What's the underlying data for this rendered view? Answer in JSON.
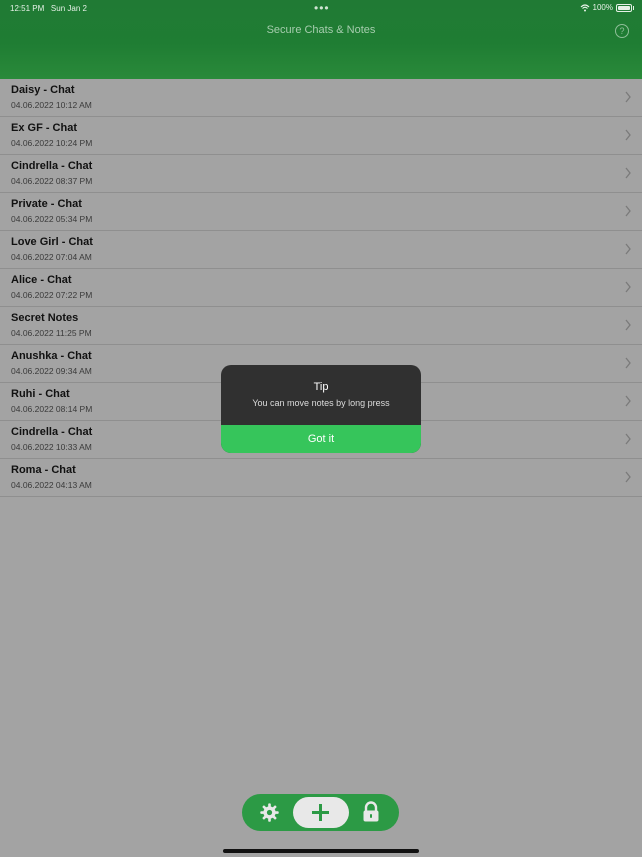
{
  "status_bar": {
    "time": "12:51 PM",
    "date": "Sun Jan 2",
    "battery": "100%"
  },
  "header": {
    "title": "Secure Chats & Notes",
    "help_icon": "question-mark-icon"
  },
  "chats": [
    {
      "name": "Daisy - Chat",
      "date": "04.06.2022 10:12 AM"
    },
    {
      "name": "Ex GF - Chat",
      "date": "04.06.2022 10:24 PM"
    },
    {
      "name": "Cindrella - Chat",
      "date": "04.06.2022 08:37 PM"
    },
    {
      "name": "Private - Chat",
      "date": "04.06.2022 05:34 PM"
    },
    {
      "name": "Love Girl - Chat",
      "date": "04.06.2022 07:04 AM"
    },
    {
      "name": "Alice - Chat",
      "date": "04.06.2022 07:22 PM"
    },
    {
      "name": "Secret Notes",
      "date": "04.06.2022 11:25 PM"
    },
    {
      "name": "Anushka - Chat",
      "date": "04.06.2022 09:34 AM"
    },
    {
      "name": "Ruhi - Chat",
      "date": "04.06.2022 08:14 PM"
    },
    {
      "name": "Cindrella - Chat",
      "date": "04.06.2022 10:33 AM"
    },
    {
      "name": "Roma - Chat",
      "date": "04.06.2022 04:13 AM"
    }
  ],
  "tip_dialog": {
    "title": "Tip",
    "message": "You can move notes by long press",
    "button": "Got it"
  },
  "toolbar": {
    "icons": [
      "gear-icon",
      "plus-icon",
      "lock-icon"
    ]
  },
  "colors": {
    "header_green": "#1f7d33",
    "toolbar_green": "#2c9a45",
    "button_green": "#36c55b",
    "dialog_dark": "#303030",
    "overlay_gray": "#a3a3a3"
  }
}
